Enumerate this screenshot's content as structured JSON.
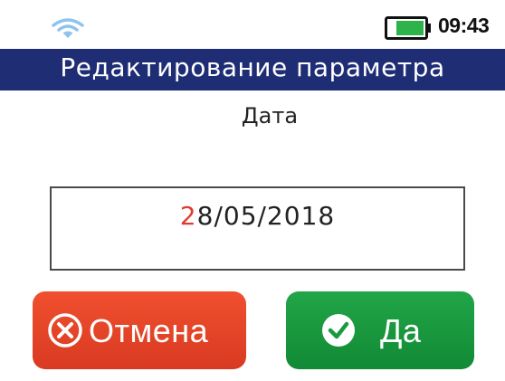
{
  "status_bar": {
    "time": "09:43",
    "wifi_icon": "wifi-icon",
    "battery_icon": "battery-icon",
    "battery_color": "#2db34a"
  },
  "header": {
    "title": "Редактирование  параметра",
    "background_color": "#1f2e74"
  },
  "parameter": {
    "name": "Дата"
  },
  "date_input": {
    "cursor_digit": "2",
    "rest_value": "8/05/2018",
    "cursor_color": "#e03c2e"
  },
  "buttons": {
    "cancel": {
      "label": "Отмена",
      "icon": "cancel-x-icon",
      "color": "#e8472a"
    },
    "ok": {
      "label": "Да",
      "icon": "check-circle-icon",
      "color": "#1a9a3f"
    }
  }
}
